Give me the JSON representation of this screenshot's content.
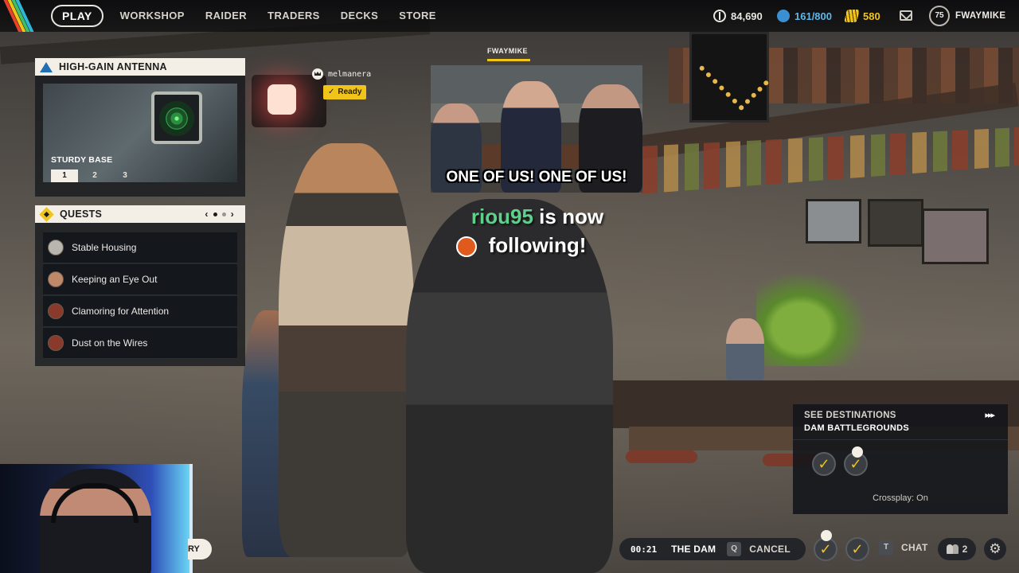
{
  "nav": {
    "items": [
      {
        "label": "PLAY",
        "active": true
      },
      {
        "label": "WORKSHOP",
        "active": false
      },
      {
        "label": "RAIDER",
        "active": false
      },
      {
        "label": "TRADERS",
        "active": false
      },
      {
        "label": "DECKS",
        "active": false
      },
      {
        "label": "STORE",
        "active": false
      }
    ]
  },
  "currencies": {
    "coins": "84,690",
    "blue_points": "161/800",
    "raider_tokens": "580"
  },
  "profile": {
    "level": "75",
    "username": "FWAYMIKE"
  },
  "workshop_panel": {
    "title": "HIGH-GAIN ANTENNA",
    "item_name": "STURDY BASE",
    "tiers": [
      "1",
      "2",
      "3"
    ],
    "active_tier": "1"
  },
  "quests_panel": {
    "title": "QUESTS",
    "prev": "‹",
    "next": "›",
    "items": [
      {
        "label": "Stable Housing",
        "icon": "character-portrait-icon"
      },
      {
        "label": "Keeping an Eye Out",
        "icon": "character-portrait-icon"
      },
      {
        "label": "Clamoring for Attention",
        "icon": "character-portrait-icon"
      },
      {
        "label": "Dust on the Wires",
        "icon": "character-portrait-icon"
      }
    ]
  },
  "party": {
    "member_name": "melmanera",
    "status": "Ready",
    "status_check": "✓"
  },
  "stream_overlay": {
    "streamer_label": "FWAYMIKE",
    "meme_caption": "ONE OF US! ONE OF US!",
    "follow_name": "riou95",
    "follow_text_1": "is now",
    "follow_text_2": "following!"
  },
  "hint_pill": {
    "text": "RY"
  },
  "destinations": {
    "title": "SEE DESTINATIONS",
    "name": "DAM BATTLEGROUNDS",
    "arrow": "▸▸▸",
    "member_check": "✓",
    "crossplay": "Crossplay: On"
  },
  "bottom_bar": {
    "timer": "00:21",
    "map_name": "THE DAM",
    "cancel_key": "Q",
    "cancel_label": "CANCEL",
    "member_check": "✓",
    "chat_key": "T",
    "chat_label": "CHAT",
    "friends_count": "2",
    "settings_icon": "⚙"
  },
  "colors": {
    "accent_yellow": "#f0c419",
    "follow_green": "#5fd08b",
    "blue_points": "#5fb7e8",
    "panel_header": "#f3efe6"
  }
}
